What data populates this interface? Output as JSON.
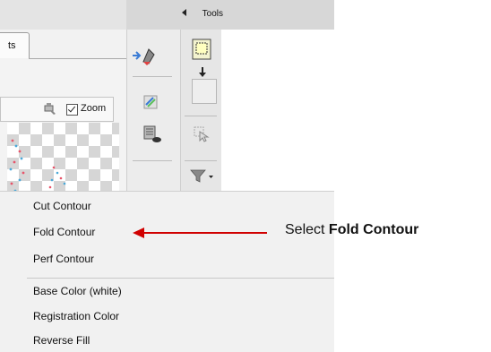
{
  "header": {
    "tools_label": "Tools"
  },
  "panel": {
    "tab_label": "ts",
    "zoom_label": "Zoom",
    "zoom_checked": true
  },
  "menu": {
    "items": [
      "Cut Contour",
      "Fold Contour",
      "Perf  Contour",
      "Base Color (white)",
      "Registration Color",
      "Reverse Fill"
    ]
  },
  "annotation": {
    "prefix": "Select ",
    "emphasis": "Fold Contour",
    "color": "#d00000"
  }
}
